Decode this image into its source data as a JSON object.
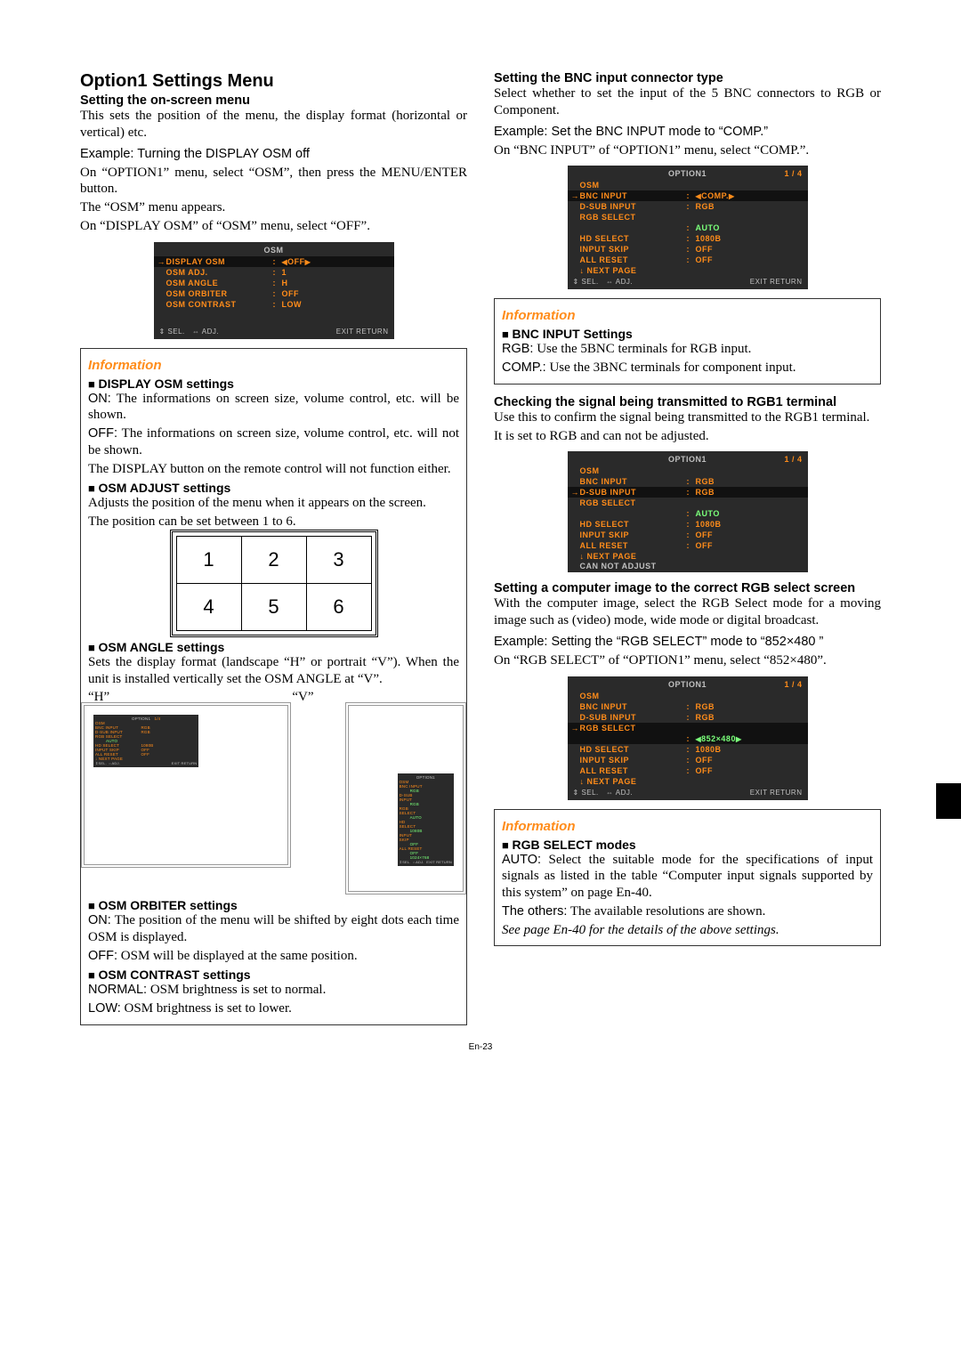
{
  "page_number": "En-23",
  "left": {
    "section_title": "Option1 Settings Menu",
    "h2a": "Setting the on-screen menu",
    "p1": "This sets the position of the menu, the display format (horizontal or vertical) etc.",
    "ex1": "Example: Turning the DISPLAY OSM off",
    "p2": "On “OPTION1” menu, select “OSM”, then press the MENU/ENTER button.",
    "p3": "The “OSM” menu appears.",
    "p4": "On “DISPLAY OSM” of “OSM” menu, select “OFF”.",
    "osm_panel": {
      "title": "OSM",
      "rows": [
        {
          "lbl": "DISPLAY OSM",
          "val": "OFF",
          "sel": true,
          "arrows": true
        },
        {
          "lbl": "OSM ADJ.",
          "val": "1"
        },
        {
          "lbl": "OSM ANGLE",
          "val": "H"
        },
        {
          "lbl": "OSM ORBITER",
          "val": "OFF"
        },
        {
          "lbl": "OSM CONTRAST",
          "val": "LOW"
        }
      ],
      "foot_sel": "SEL.",
      "foot_adj": "ADJ.",
      "foot_ret": "EXIT RETURN"
    },
    "info": "Information",
    "b1": "DISPLAY OSM settings",
    "b1_on": "ON:",
    "b1_on_t": "The informations on screen size, volume control, etc. will be shown.",
    "b1_off": "OFF:",
    "b1_off_t": "The informations on screen size, volume control, etc. will not be shown.",
    "b1_p": "The DISPLAY button on the remote control will not function either.",
    "b2": "OSM ADJUST settings",
    "b2_p1": "Adjusts the position of the menu when it appears on the screen.",
    "b2_p2": "The position can be set between 1 to 6.",
    "grid": [
      "1",
      "2",
      "3",
      "4",
      "5",
      "6"
    ],
    "b3": "OSM ANGLE settings",
    "b3_p": "Sets the display format (landscape “H” or portrait “V”). When the unit is installed vertically set the OSM ANGLE at “V”.",
    "h_label": "“H”",
    "v_label": "“V”",
    "tiny": {
      "title": "OPTION1",
      "pg": "1/4",
      "rows": [
        {
          "l": "OSM",
          "v": ""
        },
        {
          "l": "BNC INPUT",
          "v": "RGB"
        },
        {
          "l": "D-SUB INPUT",
          "v": "RGB"
        },
        {
          "l": "RGB SELECT",
          "v": ""
        },
        {
          "sub": "AUTO"
        },
        {
          "l": "HD SELECT",
          "v": "1080B"
        },
        {
          "l": "INPUT SKIP",
          "v": "OFF"
        },
        {
          "l": "ALL RESET",
          "v": "OFF"
        },
        {
          "l": "↓ NEXT PAGE",
          "v": ""
        }
      ],
      "foot_ret": "EXIT RETURN"
    },
    "tiny_v_extra": "1024×768",
    "b4": "OSM ORBITER settings",
    "b4_on": "ON:",
    "b4_on_t": "The position of the menu will be shifted by eight dots each time OSM is displayed.",
    "b4_off": "OFF:",
    "b4_off_t": "OSM will be displayed at the same position.",
    "b5": "OSM CONTRAST settings",
    "b5_n": "NORMAL:",
    "b5_n_t": "OSM brightness is set to normal.",
    "b5_l": "LOW:",
    "b5_l_t": "OSM brightness is set to lower."
  },
  "right": {
    "h1": "Setting the BNC input connector type",
    "p1": "Select whether to set the input of the 5 BNC connectors to RGB or Component.",
    "ex1": "Example: Set the BNC INPUT mode to “COMP.”",
    "p2": "On “BNC INPUT” of “OPTION1” menu, select “COMP.”.",
    "panel1": {
      "title": "OPTION1",
      "pg": "1 / 4",
      "rows": [
        {
          "lbl": "OSM",
          "noval": true
        },
        {
          "lbl": "BNC INPUT",
          "val": "COMP.",
          "sel": true,
          "arrows": true
        },
        {
          "lbl": "D-SUB INPUT",
          "val": "RGB"
        },
        {
          "lbl": "RGB SELECT",
          "noval": true
        },
        {
          "sub": "AUTO"
        },
        {
          "lbl": "HD SELECT",
          "val": "1080B"
        },
        {
          "lbl": "INPUT SKIP",
          "val": "OFF"
        },
        {
          "lbl": "ALL RESET",
          "val": "OFF"
        },
        {
          "lbl": "↓ NEXT PAGE",
          "noval": true
        }
      ],
      "foot_sel": "SEL.",
      "foot_adj": "ADJ.",
      "foot_ret": "EXIT RETURN"
    },
    "info": "Information",
    "b1": "BNC INPUT Settings",
    "b1_r": "RGB:",
    "b1_r_t": "Use the 5BNC terminals for RGB input.",
    "b1_c": "COMP.:",
    "b1_c_t": "Use the 3BNC terminals for component input.",
    "h2": "Checking the signal being transmitted to RGB1 terminal",
    "p3": "Use this to confirm the signal being transmitted to the RGB1 terminal.",
    "p4": "It is set to RGB and can not be adjusted.",
    "panel2": {
      "title": "OPTION1",
      "pg": "1 / 4",
      "rows": [
        {
          "lbl": "OSM",
          "noval": true
        },
        {
          "lbl": "BNC INPUT",
          "val": "RGB"
        },
        {
          "lbl": "D-SUB INPUT",
          "val": "RGB",
          "sel": true
        },
        {
          "lbl": "RGB SELECT",
          "noval": true
        },
        {
          "sub": "AUTO"
        },
        {
          "lbl": "HD SELECT",
          "val": "1080B"
        },
        {
          "lbl": "INPUT SKIP",
          "val": "OFF"
        },
        {
          "lbl": "ALL RESET",
          "val": "OFF"
        },
        {
          "lbl": "↓ NEXT PAGE",
          "noval": true
        }
      ],
      "cannot": "CAN NOT ADJUST"
    },
    "h3": "Setting a computer image to the correct RGB select screen",
    "p5": "With the computer image, select the RGB Select mode for a moving image such as (video) mode, wide mode or digital broadcast.",
    "ex2": "Example: Setting the “RGB SELECT” mode to “852×480 ”",
    "p6": "On “RGB SELECT” of “OPTION1” menu, select “852×480”.",
    "panel3": {
      "title": "OPTION1",
      "pg": "1 / 4",
      "rows": [
        {
          "lbl": "OSM",
          "noval": true
        },
        {
          "lbl": "BNC INPUT",
          "val": "RGB"
        },
        {
          "lbl": "D-SUB INPUT",
          "val": "RGB"
        },
        {
          "lbl": "RGB SELECT",
          "noval": true,
          "sel": true
        },
        {
          "sub": "852×480",
          "arrows": true,
          "selsub": true
        },
        {
          "lbl": "HD SELECT",
          "val": "1080B"
        },
        {
          "lbl": "INPUT SKIP",
          "val": "OFF"
        },
        {
          "lbl": "ALL RESET",
          "val": "OFF"
        },
        {
          "lbl": "↓ NEXT PAGE",
          "noval": true
        }
      ],
      "foot_sel": "SEL.",
      "foot_adj": "ADJ.",
      "foot_ret": "EXIT RETURN"
    },
    "b2": "RGB SELECT modes",
    "b2_a": "AUTO:",
    "b2_a_t": "Select the suitable mode for the specifications of input signals as listed in the table “Computer input signals supported by this system” on page En-40.",
    "b2_o": "The others:",
    "b2_o_t": "The available resolutions are shown.",
    "b2_ref": "See page En-40 for the details of the above settings."
  }
}
